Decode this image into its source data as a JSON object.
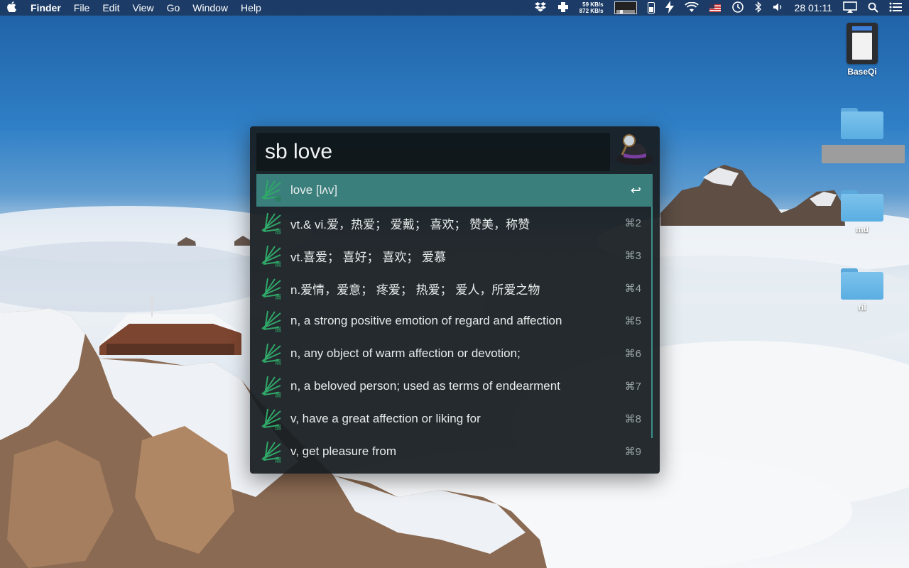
{
  "menubar": {
    "apple_icon": "apple-logo-icon",
    "app_name": "Finder",
    "menus": [
      "File",
      "Edit",
      "View",
      "Go",
      "Window",
      "Help"
    ],
    "net_up": "59 KB/s",
    "net_down": "872 KB/s",
    "clock": "28 01:11",
    "status_icons": [
      "dropbox-icon",
      "plus-cross-icon",
      "activity-graph-icon",
      "battery-icon",
      "bolt-icon",
      "wifi-icon",
      "us-flag-icon",
      "time-machine-icon",
      "bluetooth-icon",
      "volume-icon",
      "airplay-icon",
      "spotlight-search-icon",
      "notification-list-icon"
    ]
  },
  "desktop": {
    "icons": [
      {
        "label": "BaseQi",
        "type": "sd-card"
      },
      {
        "label": "",
        "type": "folder"
      },
      {
        "label": "md",
        "type": "folder"
      },
      {
        "label": "ril",
        "type": "folder"
      }
    ]
  },
  "alfred": {
    "query": "sb love",
    "results": [
      {
        "title": "love [lʌv]",
        "shortcut": "↩",
        "selected": true
      },
      {
        "title": " vt.& vi.爱，热爱； 爱戴； 喜欢； 赞美，称赞",
        "shortcut": "⌘2"
      },
      {
        "title": "vt.喜爱； 喜好； 喜欢； 爱慕",
        "shortcut": "⌘3"
      },
      {
        "title": "n.爱情，爱意； 疼爱； 热爱； 爱人，所爱之物",
        "shortcut": "⌘4"
      },
      {
        "title": "n, a strong positive emotion of regard and affection",
        "shortcut": "⌘5"
      },
      {
        "title": "n, any object of warm affection or devotion;",
        "shortcut": "⌘6"
      },
      {
        "title": "n, a beloved person; used as terms of endearment",
        "shortcut": "⌘7"
      },
      {
        "title": "v, have a great affection or liking for",
        "shortcut": "⌘8"
      },
      {
        "title": "v, get pleasure from",
        "shortcut": "⌘9"
      }
    ],
    "result_icon_char": "扇"
  },
  "colors": {
    "selected_row": "#3a7f7c",
    "window_bg": "#181e22",
    "leaf_green": "#2fa868"
  }
}
